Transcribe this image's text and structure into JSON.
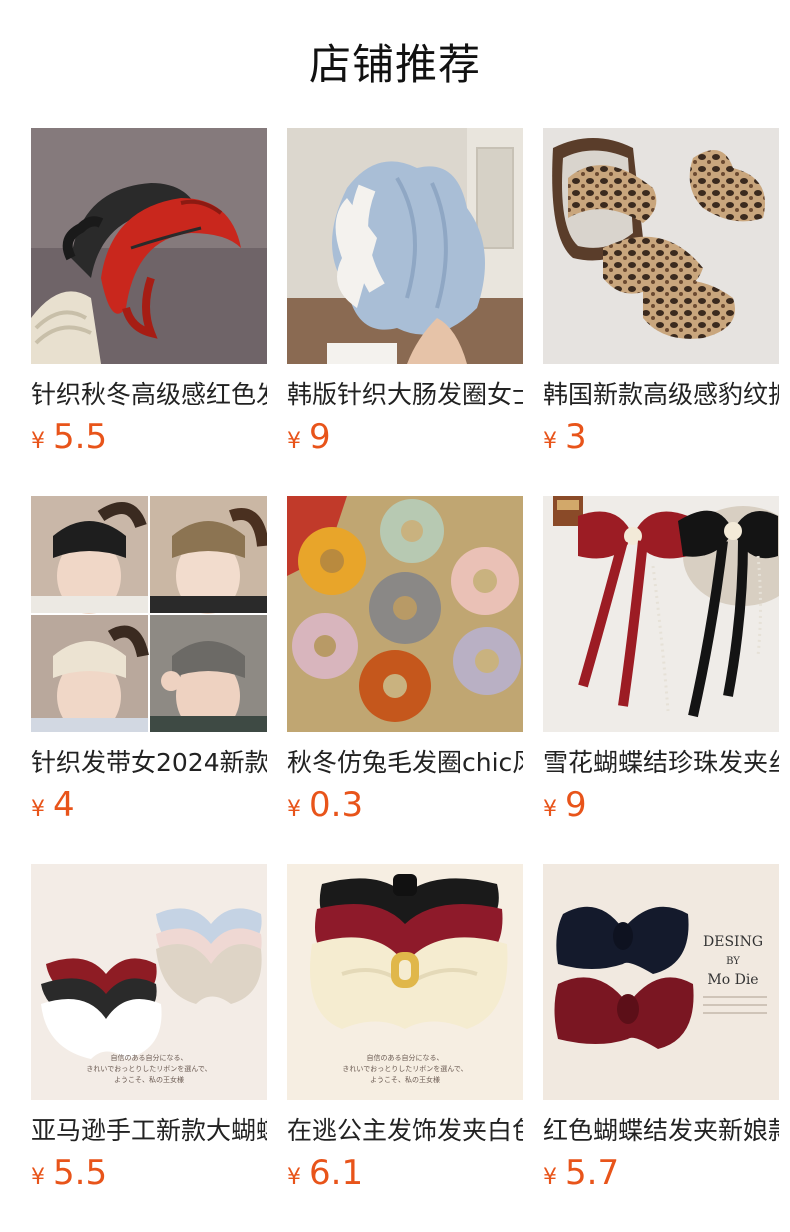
{
  "page_title": "店铺推荐",
  "colors": {
    "price": "#e8541a",
    "title": "#111111",
    "text": "#222222"
  },
  "products": [
    {
      "name": "针织秋冬高级感红色发箍",
      "currency": "¥",
      "price": "5.5",
      "icon": "red-black-knit-headband-photo"
    },
    {
      "name": "韩版针织大肠发圈女士",
      "currency": "¥",
      "price": "9",
      "icon": "blue-white-knit-scrunchie-photo"
    },
    {
      "name": "韩国新款高级感豹纹抓夹",
      "currency": "¥",
      "price": "3",
      "icon": "leopard-claw-clip-photo"
    },
    {
      "name": "针织发带女2024新款",
      "currency": "¥",
      "price": "4",
      "icon": "knit-headband-models-photo"
    },
    {
      "name": "秋冬仿兔毛发圈chic风",
      "currency": "¥",
      "price": "0.3",
      "icon": "faux-fur-scrunchies-photo"
    },
    {
      "name": "雪花蝴蝶结珍珠发夹丝带",
      "currency": "¥",
      "price": "9",
      "icon": "bow-pearl-hairclip-photo"
    },
    {
      "name": "亚马逊手工新款大蝴蝶结",
      "currency": "¥",
      "price": "5.5",
      "icon": "large-bows-photo",
      "image_text": [
        "自信のある自分になる、",
        "きれいでおっとりしたリボンを選んで、",
        "ようこそ、私の王女様"
      ]
    },
    {
      "name": "在逃公主发饰发夹白色",
      "currency": "¥",
      "price": "6.1",
      "icon": "satin-bow-clip-photo",
      "image_text": [
        "自信のある自分になる、",
        "きれいでおっとりしたリボンを選んで、",
        "ようこそ、私の王女様"
      ]
    },
    {
      "name": "红色蝴蝶结发夹新娘款",
      "currency": "¥",
      "price": "5.7",
      "icon": "red-black-bow-photo",
      "image_text": [
        "DESING",
        "BY",
        "Mo Die"
      ]
    }
  ]
}
